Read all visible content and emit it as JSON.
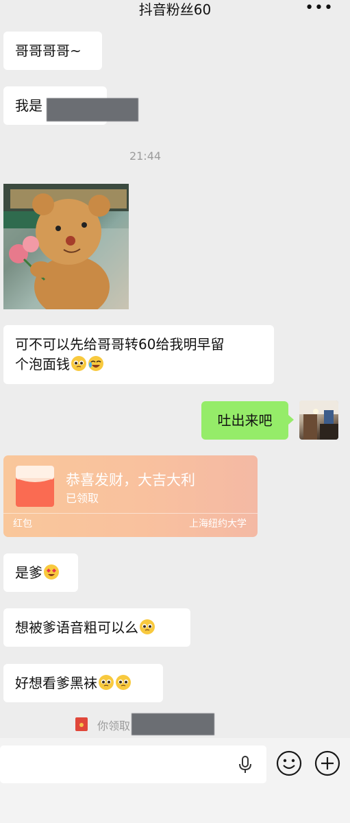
{
  "header": {
    "title": "抖音粉丝60",
    "more": "•••"
  },
  "messages": {
    "m1": "哥哥哥哥~",
    "m2": "我是",
    "time": "21:44",
    "m3_line1": "可不可以先给哥哥转60给我明早留",
    "m3_line2": "个泡面钱",
    "reply": "吐出来吧",
    "m4": "是爹",
    "m5": "想被爹语音粗可以么",
    "m6": "好想看爹黑袜"
  },
  "red_packet": {
    "title": "恭喜发财，大吉大利",
    "status": "已领取",
    "type": "红包",
    "organization": "上海纽约大学"
  },
  "system_notice": {
    "text": "你领取"
  },
  "icons": {
    "mic": "microphone-icon",
    "emoji": "emoji-face-icon",
    "plus": "plus-icon"
  },
  "colors": {
    "background": "#ededed",
    "outgoing_bubble": "#95ec69",
    "incoming_bubble": "#ffffff",
    "red_packet": "#f9c79b"
  }
}
